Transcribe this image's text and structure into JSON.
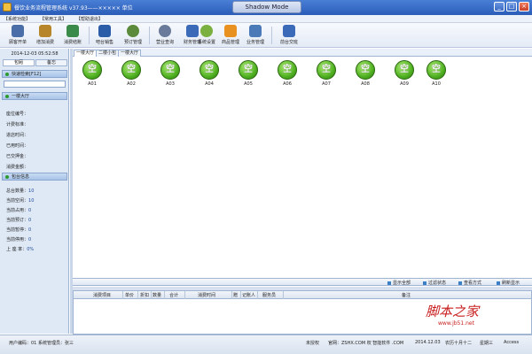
{
  "window": {
    "title": "餐饮业务流程管理系统 v37.93——××××× 单位",
    "center_label": "Shadow Mode",
    "min": "_",
    "max": "□",
    "close": "×"
  },
  "menu": [
    "【系统功能】",
    "【常用工具】",
    "【帮助退出】"
  ],
  "toolbar": [
    {
      "label": "顾客开单",
      "icon": "customer-open-icon",
      "color": "#4a6fa8"
    },
    {
      "label": "增加消费",
      "icon": "add-consume-icon",
      "color": "#b8862a"
    },
    {
      "label": "消费结账",
      "icon": "checkout-icon",
      "color": "#3a8a4a"
    },
    {
      "label": "吧台销售",
      "icon": "bar-sales-icon",
      "color": "#2a5ca8"
    },
    {
      "label": "预订管理",
      "icon": "reservation-icon",
      "color": "#5a8a3a"
    },
    {
      "label": "营业查询",
      "icon": "business-query-icon",
      "color": "#6a7a9a"
    },
    {
      "label": "财务管理",
      "icon": "finance-icon",
      "color": "#3a6ab8"
    },
    {
      "label": "系统设置",
      "icon": "settings-icon",
      "color": "#7ab040"
    },
    {
      "label": "商品管理",
      "icon": "goods-icon",
      "color": "#e89020"
    },
    {
      "label": "业务管理",
      "icon": "business-icon",
      "color": "#4a7ab8"
    },
    {
      "label": "前台交班",
      "icon": "shift-handover-icon",
      "color": "#3a6ab8"
    }
  ],
  "sidebar": {
    "datetime": "2014-12-03 05:52:58",
    "tabs": [
      "包厢",
      "备忘"
    ],
    "quick_search_title": "快速检索[F12]",
    "area_title": "一楼大厅",
    "info_labels": [
      "座位编号：",
      "计费标准：",
      "进店时间：",
      "已用时间：",
      "已交押金：",
      "消费金额："
    ],
    "stats_title": "包台信息",
    "stats": [
      {
        "label": "总台数量：",
        "value": "10"
      },
      {
        "label": "当前空闲：",
        "value": "10"
      },
      {
        "label": "当前占用：",
        "value": "0"
      },
      {
        "label": "当前预订：",
        "value": "0"
      },
      {
        "label": "当前暂停：",
        "value": "0"
      },
      {
        "label": "当前停用：",
        "value": "0"
      },
      {
        "label": "上 座 率：",
        "value": "0%"
      }
    ]
  },
  "area_tabs": [
    "一楼大厅",
    "二楼小包",
    "一楼大厅"
  ],
  "rooms": [
    {
      "code": "A01",
      "state": "空"
    },
    {
      "code": "A02",
      "state": "空"
    },
    {
      "code": "A03",
      "state": "空"
    },
    {
      "code": "A04",
      "state": "空"
    },
    {
      "code": "A05",
      "state": "空"
    },
    {
      "code": "A06",
      "state": "空"
    },
    {
      "code": "A07",
      "state": "空"
    },
    {
      "code": "A08",
      "state": "空"
    },
    {
      "code": "A09",
      "state": "空"
    },
    {
      "code": "A10",
      "state": "空"
    }
  ],
  "status_buttons": [
    "显示全部",
    "过滤状态",
    "查看方式",
    "刷新显示"
  ],
  "detail_columns": [
    "消费项目",
    "单价",
    "折扣",
    "数量",
    "合计",
    "消费时间",
    "赠",
    "记账人",
    "服务员",
    "备注"
  ],
  "statusbar": [
    "用户编码：01 系统管理员：张三",
    "未授权",
    "官网：ZSHX.COM 权 智能软件 .COM",
    "2014.12.03",
    "农历十月十二",
    "星期三",
    "Access"
  ],
  "watermark": {
    "text": "脚本之家",
    "url": "www.jb51.net"
  },
  "colors": {
    "title_bar": "#2a5cb8",
    "room_free": "#4fb020",
    "sidebar_bg": "#dfe9f6"
  }
}
